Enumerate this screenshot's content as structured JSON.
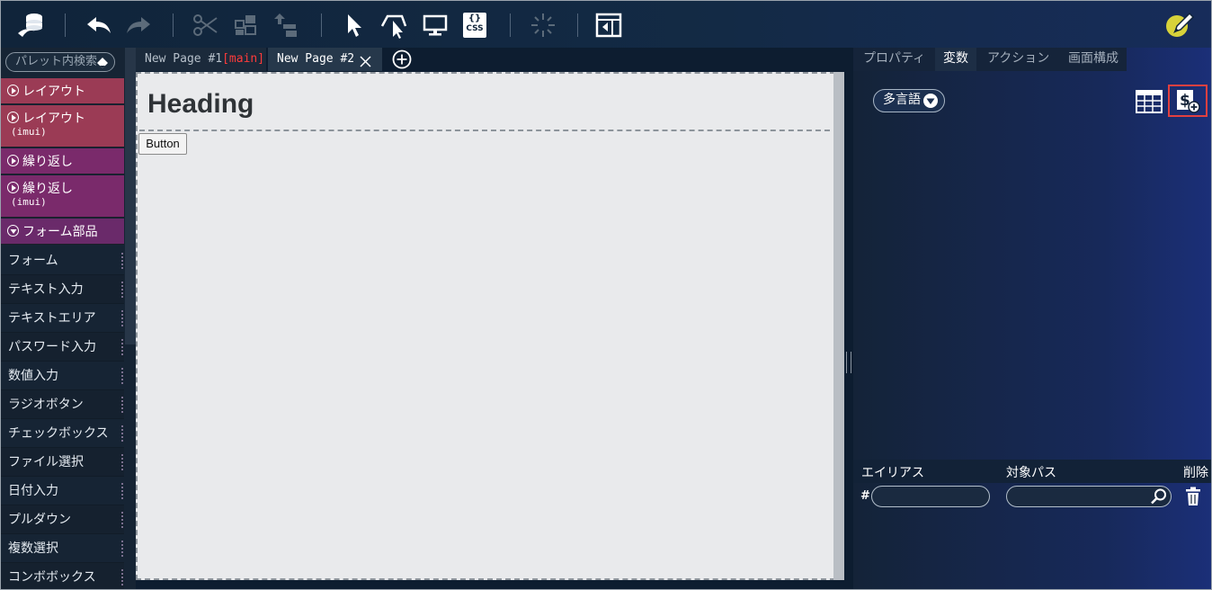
{
  "toolbar": {
    "buttons": [
      "app-logo-icon",
      "undo-icon",
      "redo-icon",
      "cut-icon",
      "component-icon",
      "move-up-icon",
      "select-pointer-icon",
      "select-area-icon",
      "preview-monitor-icon",
      "css-icon",
      "loading-icon",
      "panel-layout-icon",
      "edit-pencil-icon"
    ],
    "css_label": "CSS"
  },
  "palette": {
    "search_placeholder": "パレット内検索",
    "categories": [
      {
        "label": "レイアウト",
        "sub": "",
        "color": "#9b3b55"
      },
      {
        "label": "レイアウト",
        "sub": "(imui)",
        "color": "#9b3b55"
      },
      {
        "label": "繰り返し",
        "sub": "",
        "color": "#7a2a6b"
      },
      {
        "label": "繰り返し",
        "sub": "(imui)",
        "color": "#7a2a6b"
      },
      {
        "label": "フォーム部品",
        "sub": "",
        "color": "#6a2a6a"
      }
    ],
    "items": [
      "フォーム",
      "テキスト入力",
      "テキストエリア",
      "パスワード入力",
      "数値入力",
      "ラジオボタン",
      "チェックボックス",
      "ファイル選択",
      "日付入力",
      "プルダウン",
      "複数選択",
      "コンボボックス"
    ]
  },
  "tabs": {
    "tab1_label": "New Page #1",
    "tab1_badge": "[main]",
    "tab2_label": "New Page #2"
  },
  "canvas": {
    "heading": "Heading",
    "button_label": "Button"
  },
  "right_panel": {
    "tabs": [
      "プロパティ",
      "変数",
      "アクション",
      "画面構成"
    ],
    "active_tab": "変数",
    "lang_button": "多言語",
    "table_headers": {
      "alias": "エイリアス",
      "path": "対象パス",
      "delete": "削除"
    },
    "row_hash": "#"
  }
}
